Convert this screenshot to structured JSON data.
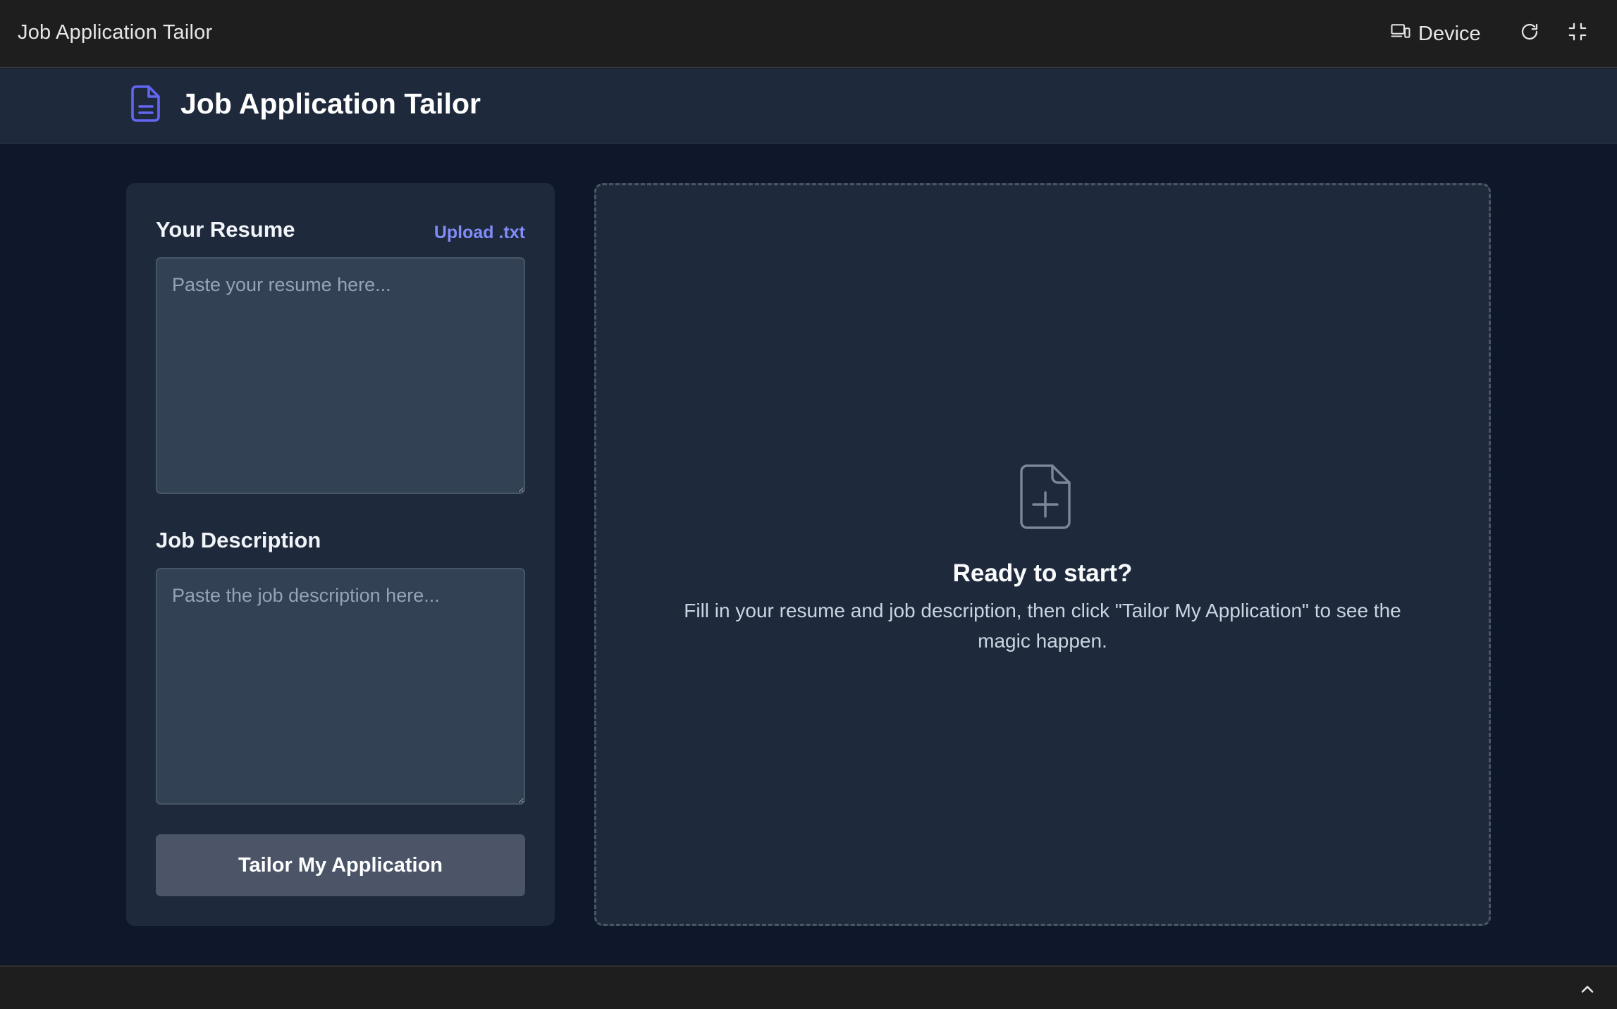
{
  "topbar": {
    "title": "Job Application Tailor",
    "device_label": "Device",
    "icons": [
      "device-icon",
      "refresh-icon",
      "collapse-icon"
    ]
  },
  "header": {
    "title": "Job Application Tailor",
    "logo_icon": "document-icon"
  },
  "form": {
    "resume": {
      "label": "Your Resume",
      "upload_label": "Upload .txt",
      "placeholder": "Paste your resume here...",
      "value": ""
    },
    "job_description": {
      "label": "Job Description",
      "placeholder": "Paste the job description here...",
      "value": ""
    },
    "submit_label": "Tailor My Application"
  },
  "result": {
    "icon": "document-plus-icon",
    "title": "Ready to start?",
    "description": "Fill in your resume and job description, then click \"Tailor My Application\" to see the magic happen."
  },
  "bottombar": {
    "icon": "chevron-up-icon"
  },
  "colors": {
    "page_bg": "#0f172a",
    "card_bg": "#1e293b",
    "accent": "#818cf8",
    "logo": "#6366f1",
    "button_bg": "#4b5567"
  }
}
